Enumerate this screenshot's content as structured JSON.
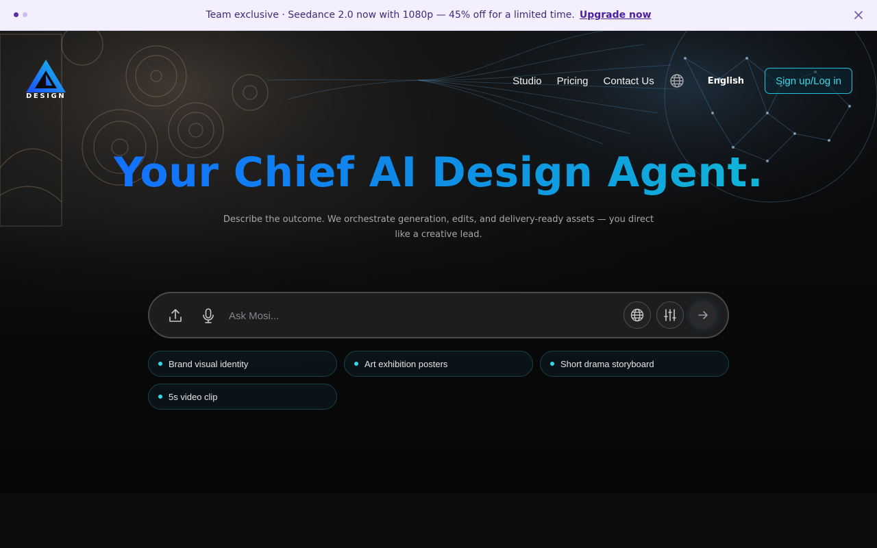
{
  "banner": {
    "text": "Team exclusive · Seedance 2.0 now with 1080p — 45% off for a limited time.",
    "link_label": "Upgrade now",
    "slides": 2,
    "active_slide": 1
  },
  "brand": {
    "logo_text": "DESIGN"
  },
  "nav": {
    "links": [
      "Studio",
      "Pricing",
      "Contact Us"
    ],
    "language": "English",
    "signup_label": "Sign up/Log in"
  },
  "hero": {
    "headline": "Your Chief AI Design Agent.",
    "subtitle": "Describe the outcome. We orchestrate generation, edits, and delivery-ready assets — you direct like a creative lead."
  },
  "prompt": {
    "placeholder": "Ask Mosi..."
  },
  "suggestions": [
    "Brand visual identity",
    "Art exhibition posters",
    "Short drama storyboard",
    "5s video clip"
  ],
  "colors": {
    "accent": "#22c3dc",
    "headline_start": "#1272ff",
    "headline_end": "#10b5d6",
    "banner_bg": "#f3efff",
    "banner_text": "#3f2a78"
  },
  "icons": [
    "dots-icon",
    "close-icon",
    "logo-icon",
    "globe-icon",
    "upload-icon",
    "microphone-icon",
    "web-search-icon",
    "settings-sliders-icon",
    "arrow-right-icon"
  ]
}
